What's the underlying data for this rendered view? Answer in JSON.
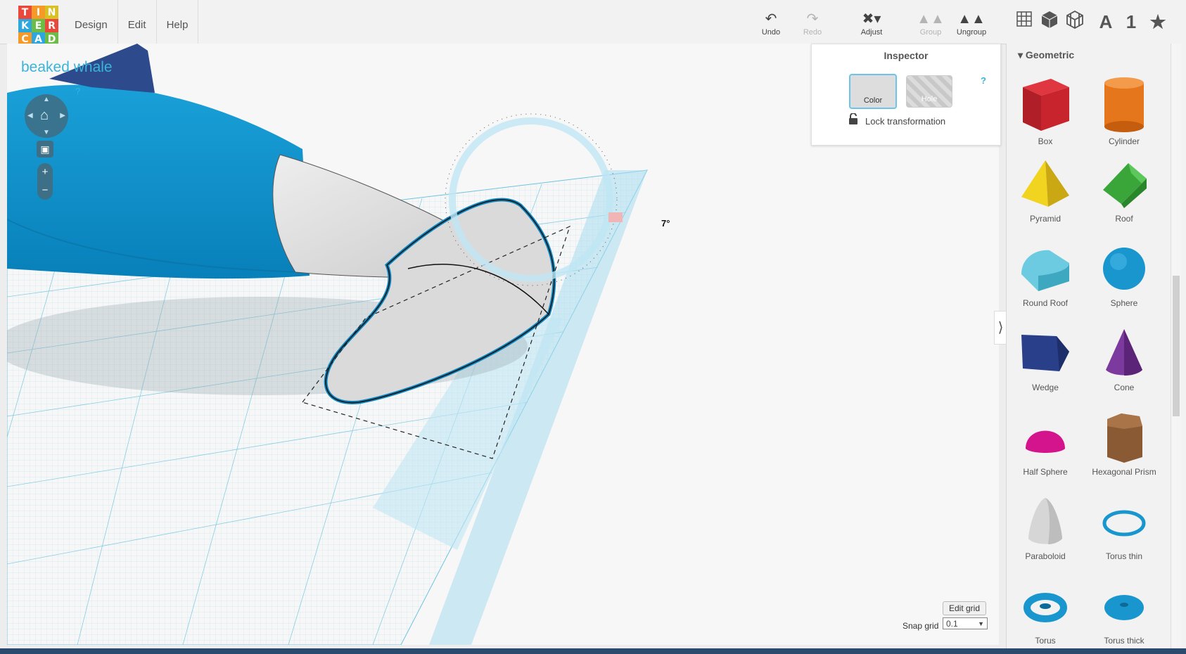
{
  "logo": {
    "letters": [
      "T",
      "I",
      "N",
      "K",
      "E",
      "R",
      "C",
      "A",
      "D"
    ],
    "colors": [
      "#e9493c",
      "#f59a27",
      "#d8c223",
      "#2ea6de",
      "#6cbd45",
      "#e9493c",
      "#f59a27",
      "#2ea6de",
      "#6cbd45"
    ]
  },
  "menu": {
    "items": [
      {
        "label": "Design"
      },
      {
        "label": "Edit"
      },
      {
        "label": "Help"
      }
    ]
  },
  "toolbar": {
    "undo": {
      "label": "Undo",
      "icon": "undo-icon"
    },
    "redo": {
      "label": "Redo",
      "icon": "redo-icon",
      "disabled": true
    },
    "adjust": {
      "label": "Adjust",
      "icon": "adjust-icon"
    },
    "group": {
      "label": "Group",
      "icon": "group-icon",
      "disabled": true
    },
    "ungroup": {
      "label": "Ungroup",
      "icon": "ungroup-icon"
    },
    "views": [
      {
        "name": "grid-icon"
      },
      {
        "name": "box-icon"
      },
      {
        "name": "wireframe-box-icon"
      },
      {
        "name": "text-icon",
        "label": "A"
      },
      {
        "name": "number-icon",
        "label": "1"
      },
      {
        "name": "star-icon"
      }
    ]
  },
  "design": {
    "title": "beaked whale",
    "help": "?"
  },
  "viewport": {
    "rotation_label": "7°"
  },
  "inspector": {
    "title": "Inspector",
    "color_label": "Color",
    "hole_label": "Hole",
    "lock_label": "Lock transformation",
    "help": "?"
  },
  "grid": {
    "edit_label": "Edit grid",
    "snap_label": "Snap grid",
    "snap_value": "0.1"
  },
  "sidebar": {
    "category": "Geometric",
    "shapes": [
      {
        "label": "Box",
        "icon": "box-shape-icon",
        "color": "#c8242d"
      },
      {
        "label": "Cylinder",
        "icon": "cylinder-shape-icon",
        "color": "#e6761c"
      },
      {
        "label": "Pyramid",
        "icon": "pyramid-shape-icon",
        "color": "#e8c81c"
      },
      {
        "label": "Roof",
        "icon": "roof-shape-icon",
        "color": "#3aa63a"
      },
      {
        "label": "Round Roof",
        "icon": "round-roof-shape-icon",
        "color": "#5fbfd0"
      },
      {
        "label": "Sphere",
        "icon": "sphere-shape-icon",
        "color": "#1a96cf"
      },
      {
        "label": "Wedge",
        "icon": "wedge-shape-icon",
        "color": "#2a3f8a"
      },
      {
        "label": "Cone",
        "icon": "cone-shape-icon",
        "color": "#7d3a9e"
      },
      {
        "label": "Half Sphere",
        "icon": "half-sphere-shape-icon",
        "color": "#d4148c"
      },
      {
        "label": "Hexagonal Prism",
        "icon": "hexagonal-prism-shape-icon",
        "color": "#8a5a34"
      },
      {
        "label": "Paraboloid",
        "icon": "paraboloid-shape-icon",
        "color": "#d6d6d6"
      },
      {
        "label": "Torus thin",
        "icon": "torus-thin-shape-icon",
        "color": "#1a96cf"
      },
      {
        "label": "Torus",
        "icon": "torus-shape-icon",
        "color": "#1a96cf"
      },
      {
        "label": "Torus thick",
        "icon": "torus-thick-shape-icon",
        "color": "#1a96cf"
      }
    ]
  }
}
